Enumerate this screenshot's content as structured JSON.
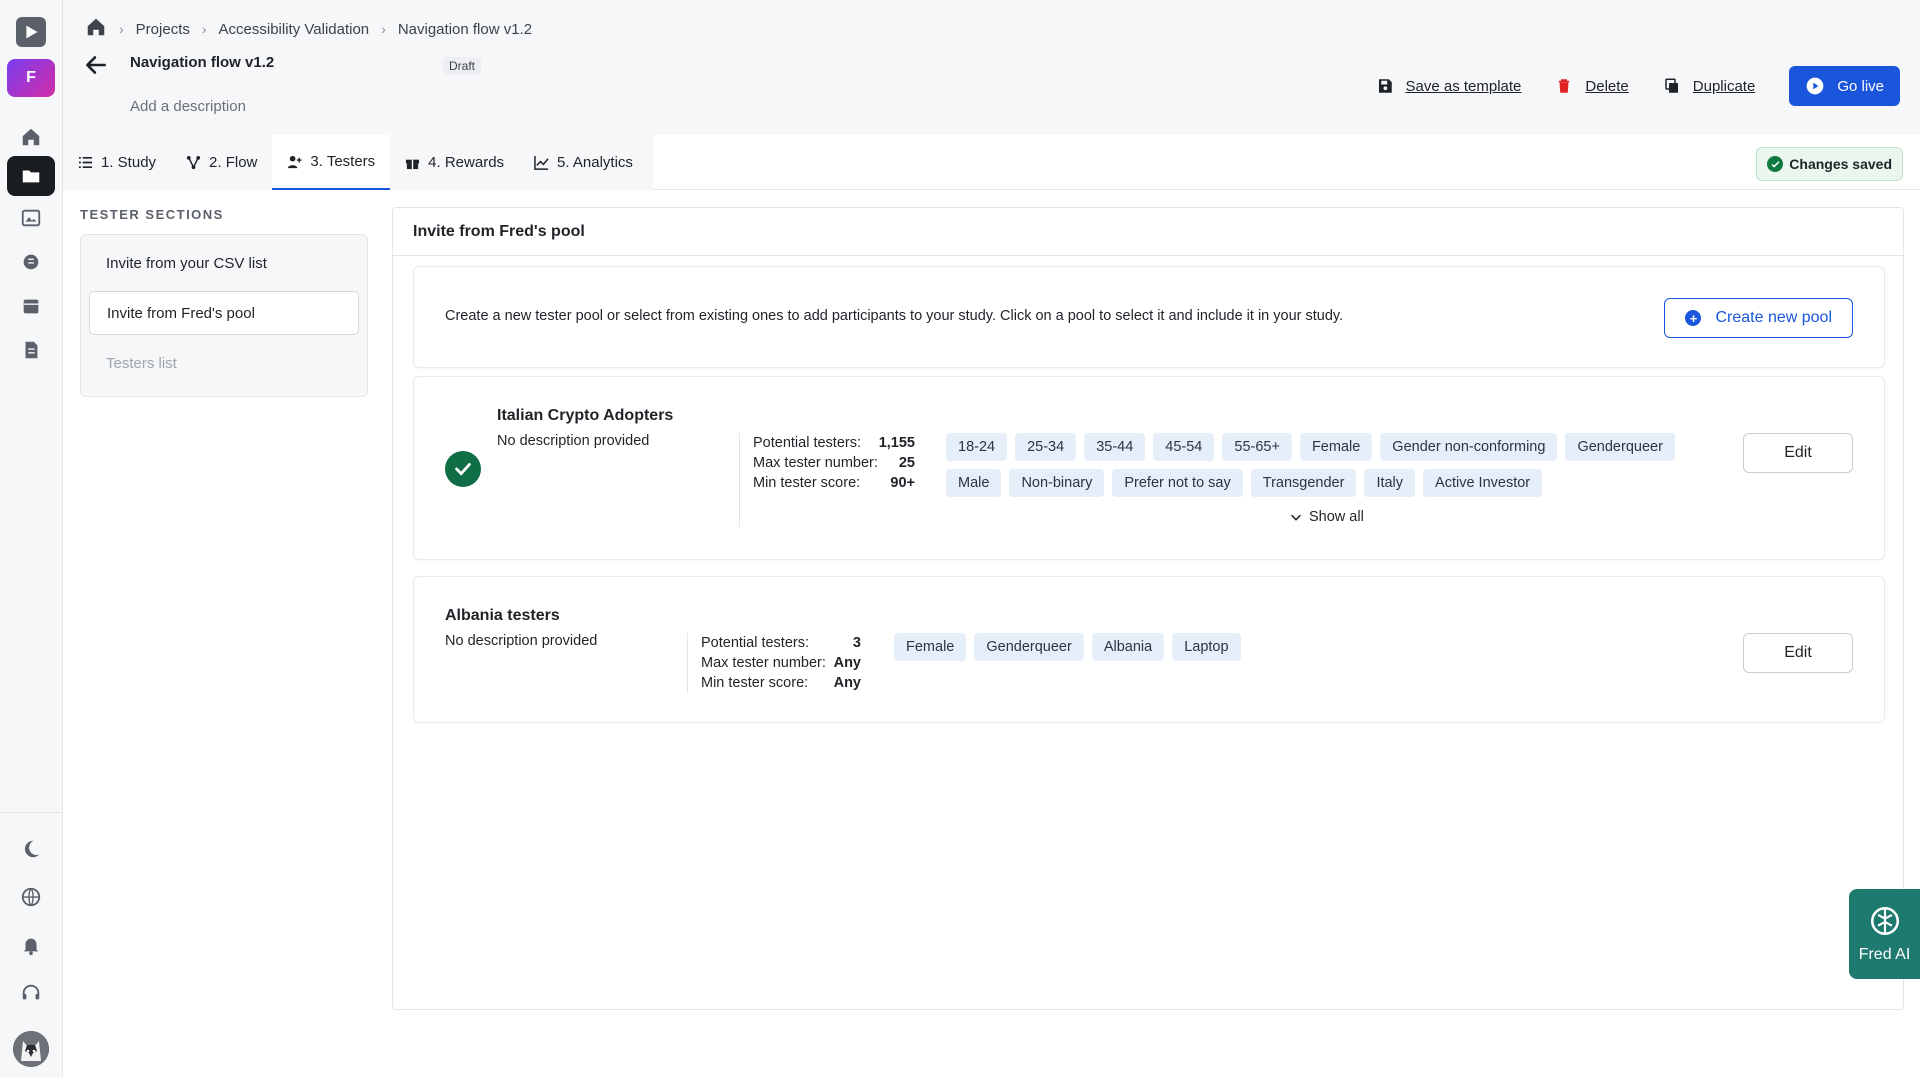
{
  "rail": {
    "logo_icon": "play-icon",
    "workspace_initial": "F",
    "items": [
      "home-icon",
      "folder-icon",
      "gallery-icon",
      "brain-icon",
      "calendar-icon",
      "document-icon"
    ],
    "bottom_items": [
      "moon-icon",
      "globe-icon",
      "bell-icon",
      "headset-icon"
    ]
  },
  "breadcrumb": {
    "items": [
      "Projects",
      "Accessibility Validation",
      "Navigation flow v1.2"
    ]
  },
  "header": {
    "title": "Navigation flow v1.2",
    "status_badge": "Draft",
    "add_description": "Add a description",
    "save_template": "Save as template",
    "delete": "Delete",
    "duplicate": "Duplicate",
    "go_live": "Go live"
  },
  "tabs": [
    {
      "label": "1. Study"
    },
    {
      "label": "2. Flow"
    },
    {
      "label": "3. Testers"
    },
    {
      "label": "4. Rewards"
    },
    {
      "label": "5. Analytics"
    }
  ],
  "active_tab": "3. Testers",
  "changes_saved": "Changes saved",
  "sidebar": {
    "title": "TESTER SECTIONS",
    "items": [
      {
        "label": "Invite from your CSV list"
      },
      {
        "label": "Invite from Fred's pool"
      },
      {
        "label": "Testers list"
      }
    ]
  },
  "main": {
    "title": "Invite from Fred's pool",
    "intro": "Create a new tester pool or select from existing ones to add participants to your study. Click on a pool to select it and include it in your study.",
    "create_pool": "Create new pool",
    "pools": [
      {
        "name": "Italian Crypto Adopters",
        "description": "No description provided",
        "selected": true,
        "potential_label": "Potential testers:",
        "potential": "1,155",
        "max_label": "Max tester number:",
        "max": "25",
        "min_label": "Min tester score:",
        "min": "90+",
        "tags": [
          "18-24",
          "25-34",
          "35-44",
          "45-54",
          "55-65+",
          "Female",
          "Gender non-conforming",
          "Genderqueer",
          "Male",
          "Non-binary",
          "Prefer not to say",
          "Transgender",
          "Italy",
          "Active Investor"
        ],
        "show_all": "Show all",
        "edit": "Edit"
      },
      {
        "name": "Albania testers",
        "description": "No description provided",
        "selected": false,
        "potential_label": "Potential testers:",
        "potential": "3",
        "max_label": "Max tester number:",
        "max": "Any",
        "min_label": "Min tester score:",
        "min": "Any",
        "tags": [
          "Female",
          "Genderqueer",
          "Albania",
          "Laptop"
        ],
        "edit": "Edit"
      }
    ]
  },
  "fred_ai": "Fred AI",
  "colors": {
    "accent": "#1a56db",
    "success": "#0f6e45",
    "fred_ai": "#1e7a6e",
    "tag_bg": "#e6eef9",
    "delete_icon": "#e02424"
  }
}
